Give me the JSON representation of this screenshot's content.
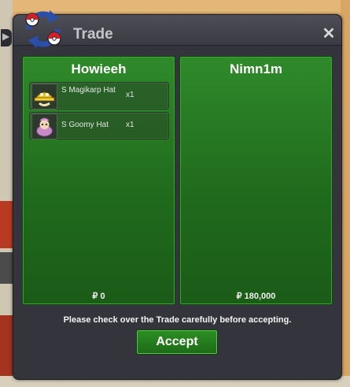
{
  "window": {
    "title": "Trade",
    "close_icon": "close-icon",
    "logo_icon": "trade-arrows-icon"
  },
  "left_panel": {
    "player": "Howieeh",
    "money": "₽ 0",
    "items": [
      {
        "name": "S Magikarp Hat",
        "qty": "x1",
        "icon": "magikarp-hat-icon"
      },
      {
        "name": "S Goomy Hat",
        "qty": "x1",
        "icon": "goomy-hat-icon"
      }
    ]
  },
  "right_panel": {
    "player": "Nimn1m",
    "money": "₽ 180,000",
    "items": []
  },
  "footer": {
    "notice": "Please check over the Trade carefully before accepting.",
    "accept_label": "Accept"
  },
  "colors": {
    "panel_green": "#2f8a2a",
    "window_bg": "#34343c",
    "accept_green": "#2c8e23"
  }
}
